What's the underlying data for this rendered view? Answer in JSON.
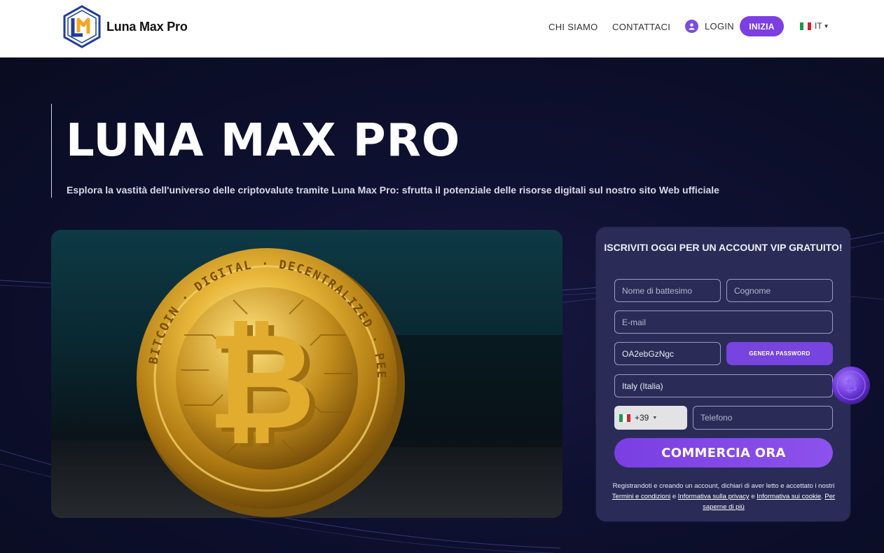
{
  "header": {
    "brand": "Luna Max Pro",
    "nav": {
      "chi_siamo": "CHI SIAMO",
      "contattaci": "CONTATTACI",
      "login": "LOGIN",
      "inizia": "INIZIA",
      "lang": "IT"
    }
  },
  "hero": {
    "title": "LUNA MAX PRO",
    "subtitle": "Esplora la vastità dell'universo delle criptovalute tramite Luna Max Pro: sfrutta il potenziale delle risorse digitali sul nostro sito Web ufficiale"
  },
  "coin": {
    "ring_top": "BITCOIN · DIGITAL · DECENTRALIZED · PEER TO PEER"
  },
  "form": {
    "title": "ISCRIVITI OGGI PER UN ACCOUNT VIP GRATUITO!",
    "first_name_placeholder": "Nome di battesimo",
    "last_name_placeholder": "Cognome",
    "email_placeholder": "E-mail",
    "password_value": "OA2ebGzNgc",
    "genera_label": "GENERA PASSWORD",
    "country_value": "Italy (Italia)",
    "phone_prefix": "+39",
    "phone_placeholder": "Telefono",
    "submit_label": "COMMERCIA ORA",
    "disclaimer": {
      "text1": "Registrandoti e creando un account, dichiari di aver letto e accettato i nostri ",
      "terms": "Termini e condizioni",
      "text2": " e ",
      "privacy": "Informativa sulla privacy",
      "text3": " e ",
      "cookie": "Informativa sui cookie",
      "text4": ". ",
      "more": "Per saperne di più"
    }
  },
  "colors": {
    "accent": "#7b3fe4",
    "hero_bg": "#0b0f24",
    "form_bg": "#2a2c57",
    "logo_blue": "#1f3d9a",
    "logo_gold": "#f4a623"
  }
}
